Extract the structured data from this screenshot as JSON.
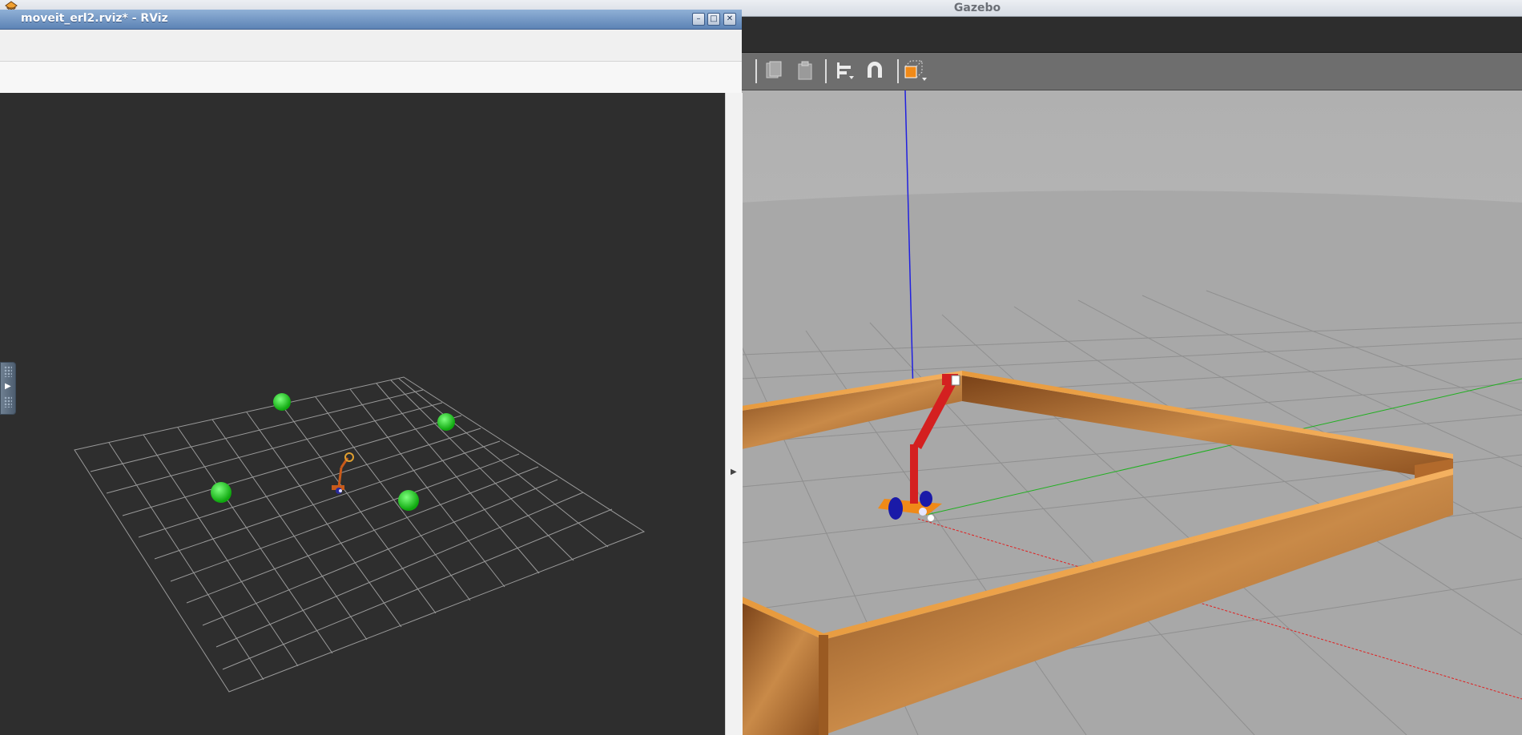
{
  "gazebo": {
    "title": "Gazebo",
    "toolbar": {
      "icons": [
        "copy-icon",
        "paste-icon",
        "align-icon",
        "snap-icon",
        "view-angle-icon"
      ]
    },
    "scene": {
      "description_colors": {
        "wall": "#b86e2b",
        "robot_arm": "#d42020",
        "robot_base": "#f08a18",
        "wheel": "#1a1aa8"
      }
    }
  },
  "rviz": {
    "title": "moveit_erl2.rviz* - RViz",
    "window_buttons": {
      "minimize": "–",
      "maximize": "□",
      "close": "✕"
    },
    "view": {
      "markers": [
        "green-sphere",
        "green-sphere",
        "green-sphere",
        "green-sphere"
      ]
    }
  },
  "colors": {
    "rviz_background": "#2e2e2e",
    "rviz_title": "#5d83b5",
    "gazebo_sky": "#b3b3b3",
    "gazebo_ground": "#a9a9a9",
    "marker": "#22d322"
  }
}
